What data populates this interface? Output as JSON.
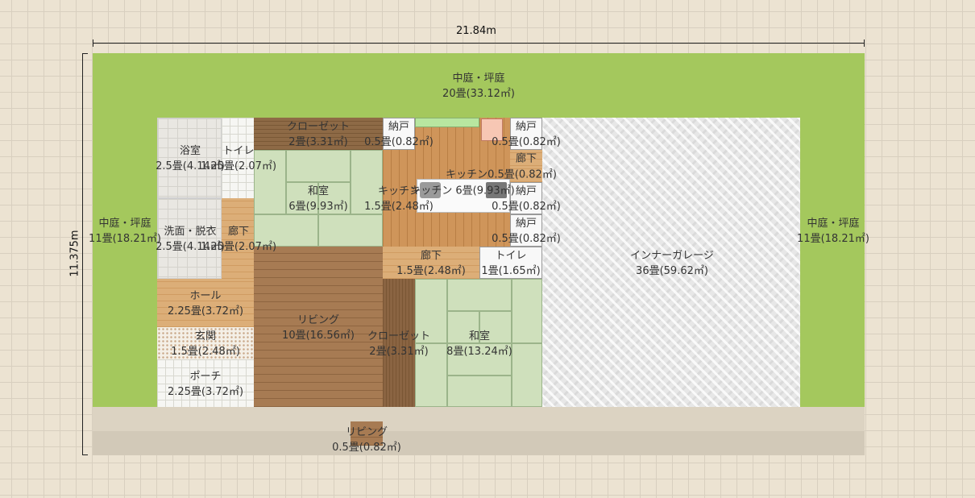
{
  "dimensions": {
    "width": "21.84m",
    "height": "11.375m"
  },
  "rooms": {
    "courtyard_top": {
      "name": "中庭・坪庭",
      "area": "20畳(33.12㎡)"
    },
    "courtyard_left": {
      "name": "中庭・坪庭",
      "area": "11畳(18.21㎡)"
    },
    "courtyard_right": {
      "name": "中庭・坪庭",
      "area": "11畳(18.21㎡)"
    },
    "bath": {
      "name": "浴室",
      "area": "2.5畳(4.14㎡)"
    },
    "toilet1": {
      "name": "トイレ",
      "area": "1.25畳(2.07㎡)"
    },
    "closet1": {
      "name": "クローゼット",
      "area": "2畳(3.31㎡)"
    },
    "storage1": {
      "name": "納戸",
      "area": "0.5畳(0.82㎡)"
    },
    "storage2": {
      "name": "納戸",
      "area": "0.5畳(0.82㎡)"
    },
    "corridor_small": {
      "name": "廊下",
      "area": "0.5畳(0.82㎡)"
    },
    "kitchen_upper": {
      "name": "キッチン",
      "area": "0.5畳(0.82㎡)"
    },
    "washroom": {
      "name": "洗面・脱衣",
      "area": "2.5畳(4.14㎡)"
    },
    "corridor_left": {
      "name": "廊下",
      "area": "1.25畳(2.07㎡)"
    },
    "japanese_room1": {
      "name": "和室",
      "area": "6畳(9.93㎡)"
    },
    "kitchen_small": {
      "name": "キッチン",
      "area": "1.5畳(2.48㎡)"
    },
    "kitchen_main": {
      "name": "キッチン",
      "area": "6畳(9.93㎡)"
    },
    "storage3": {
      "name": "納戸",
      "area": "0.5畳(0.82㎡)"
    },
    "storage4": {
      "name": "納戸",
      "area": "0.5畳(0.82㎡)"
    },
    "corridor_mid": {
      "name": "廊下",
      "area": "1.5畳(2.48㎡)"
    },
    "toilet2": {
      "name": "トイレ",
      "area": "1畳(1.65㎡)"
    },
    "hall": {
      "name": "ホール",
      "area": "2.25畳(3.72㎡)"
    },
    "entrance": {
      "name": "玄関",
      "area": "1.5畳(2.48㎡)"
    },
    "porch": {
      "name": "ポーチ",
      "area": "2.25畳(3.72㎡)"
    },
    "living": {
      "name": "リビング",
      "area": "10畳(16.56㎡)"
    },
    "closet2": {
      "name": "クローゼット",
      "area": "2畳(3.31㎡)"
    },
    "japanese_room2": {
      "name": "和室",
      "area": "8畳(13.24㎡)"
    },
    "garage": {
      "name": "インナーガレージ",
      "area": "36畳(59.62㎡)"
    },
    "living_small": {
      "name": "リビング",
      "area": "0.5畳(0.82㎡)"
    }
  }
}
